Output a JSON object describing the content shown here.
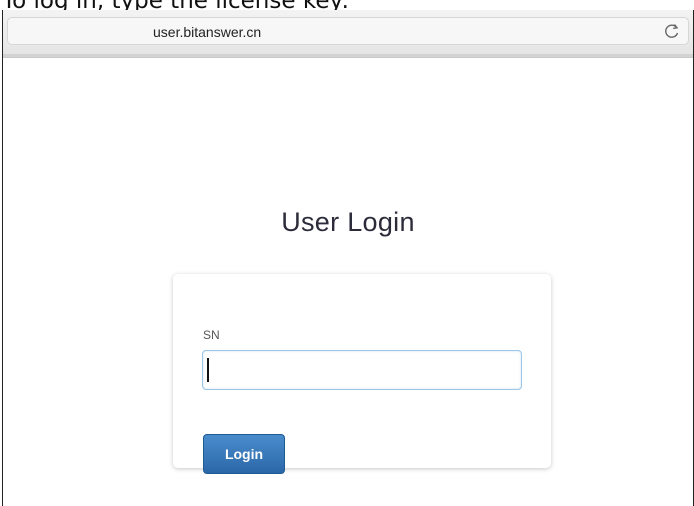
{
  "caption": "To log in, type the license key:",
  "browser": {
    "url": "user.bitanswer.cn",
    "reload_icon": "reload-icon"
  },
  "page": {
    "title": "User Login"
  },
  "form": {
    "sn_label": "SN",
    "sn_value": "",
    "login_label": "Login"
  },
  "colors": {
    "button": "#2f6fb2",
    "input_border": "#9cc5e6",
    "title": "#2b2b3a"
  }
}
